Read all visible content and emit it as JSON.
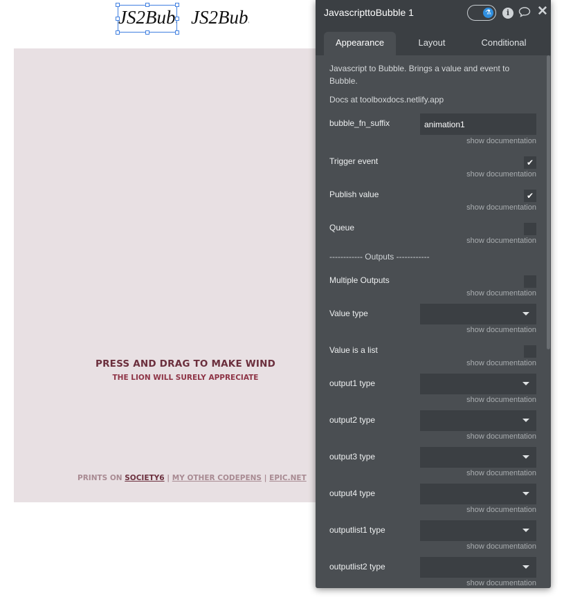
{
  "canvas": {
    "element_a_text": "JS2Bubble",
    "element_b_text": "JS2Bubble",
    "wind_title": "PRESS AND DRAG TO MAKE WIND",
    "wind_subtitle": "THE LION WILL SURELY APPRECIATE",
    "footer": {
      "prints_on": "PRINTS ON",
      "society6": "SOCIETY6",
      "sep1": "|",
      "my_other_codepens": "MY OTHER CODEPENS",
      "sep2": "|",
      "epic_net": "EPIC.NET"
    }
  },
  "panel": {
    "title": "JavascripttoBubble 1",
    "icons": [
      "toggle-switch",
      "info-icon",
      "comment-icon",
      "close-icon"
    ],
    "tabs": [
      {
        "label": "Appearance",
        "active": true
      },
      {
        "label": "Layout",
        "active": false
      },
      {
        "label": "Conditional",
        "active": false
      }
    ],
    "description": "Javascript to Bubble. Brings a value and event to Bubble.",
    "docs": "Docs at toolboxdocs.netlify.app",
    "show_doc": "show documentation",
    "separator": "------------ Outputs ------------",
    "fields": {
      "bubble_fn_suffix": {
        "label": "bubble_fn_suffix",
        "value": "animation1"
      },
      "trigger_event": {
        "label": "Trigger event",
        "checked": true
      },
      "publish_value": {
        "label": "Publish value",
        "checked": true
      },
      "queue": {
        "label": "Queue",
        "checked": false
      },
      "multiple_outputs": {
        "label": "Multiple Outputs",
        "checked": false
      },
      "value_type": {
        "label": "Value type",
        "value": ""
      },
      "value_is_list": {
        "label": "Value is a list",
        "checked": false
      },
      "output1_type": {
        "label": "output1 type",
        "value": ""
      },
      "output2_type": {
        "label": "output2 type",
        "value": ""
      },
      "output3_type": {
        "label": "output3 type",
        "value": ""
      },
      "output4_type": {
        "label": "output4 type",
        "value": ""
      },
      "outputlist1_type": {
        "label": "outputlist1 type",
        "value": ""
      },
      "outputlist2_type": {
        "label": "outputlist2 type",
        "value": ""
      }
    },
    "check_glyph": "✔",
    "colors": {
      "panel_bg": "#4a4e52",
      "header_bg": "#3b3f43",
      "accent": "#2f8fe0",
      "canvas_bg": "#e8e0e3",
      "wind_text": "#6b2f3d"
    }
  }
}
